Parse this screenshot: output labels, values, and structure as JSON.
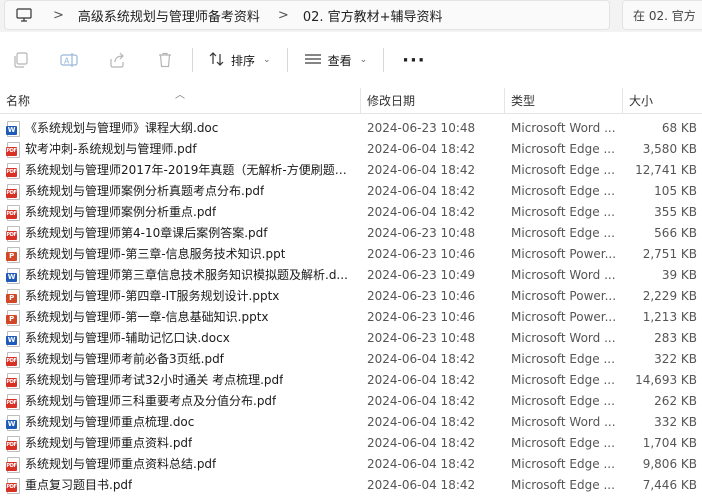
{
  "address": {
    "segments": [
      "高级系统规划与管理师备考资料",
      "02. 官方教材+辅导资料"
    ],
    "separator": ">",
    "search_placeholder": "在 02. 官方"
  },
  "toolbar": {
    "sort_label": "排序",
    "view_label": "查看",
    "more_label": "···"
  },
  "columns": {
    "name": "名称",
    "date": "修改日期",
    "type": "类型",
    "size": "大小"
  },
  "files": [
    {
      "icon": "word-icon",
      "kind": "word",
      "name": "《系统规划与管理师》课程大纲.doc",
      "date": "2024-06-23 10:48",
      "type": "Microsoft Word ...",
      "size": "68 KB"
    },
    {
      "icon": "pdf-icon",
      "kind": "pdf",
      "name": "软考冲刺-系统规划与管理师.pdf",
      "date": "2024-06-04 18:42",
      "type": "Microsoft Edge ...",
      "size": "3,580 KB"
    },
    {
      "icon": "pdf-icon",
      "kind": "pdf",
      "name": "系统规划与管理师2017年-2019年真题（无解析-方便刷题）...",
      "date": "2024-06-04 18:42",
      "type": "Microsoft Edge ...",
      "size": "12,741 KB"
    },
    {
      "icon": "pdf-icon",
      "kind": "pdf",
      "name": "系统规划与管理师案例分析真题考点分布.pdf",
      "date": "2024-06-04 18:42",
      "type": "Microsoft Edge ...",
      "size": "105 KB"
    },
    {
      "icon": "pdf-icon",
      "kind": "pdf",
      "name": "系统规划与管理师案例分析重点.pdf",
      "date": "2024-06-04 18:42",
      "type": "Microsoft Edge ...",
      "size": "355 KB"
    },
    {
      "icon": "pdf-icon",
      "kind": "pdf",
      "name": "系统规划与管理师第4-10章课后案例答案.pdf",
      "date": "2024-06-23 10:48",
      "type": "Microsoft Edge ...",
      "size": "566 KB"
    },
    {
      "icon": "ppt-icon",
      "kind": "ppt",
      "name": "系统规划与管理师-第三章-信息服务技术知识.ppt",
      "date": "2024-06-23 10:46",
      "type": "Microsoft Power...",
      "size": "2,751 KB"
    },
    {
      "icon": "word-icon",
      "kind": "word",
      "name": "系统规划与管理师第三章信息技术服务知识模拟题及解析.d...",
      "date": "2024-06-23 10:49",
      "type": "Microsoft Word ...",
      "size": "39 KB"
    },
    {
      "icon": "ppt-icon",
      "kind": "ppt",
      "name": "系统规划与管理师-第四章-IT服务规划设计.pptx",
      "date": "2024-06-23 10:46",
      "type": "Microsoft Power...",
      "size": "2,229 KB"
    },
    {
      "icon": "ppt-icon",
      "kind": "ppt",
      "name": "系统规划与管理师-第一章-信息基础知识.pptx",
      "date": "2024-06-23 10:46",
      "type": "Microsoft Power...",
      "size": "1,213 KB"
    },
    {
      "icon": "word-icon",
      "kind": "word",
      "name": "系统规划与管理师-辅助记忆口诀.docx",
      "date": "2024-06-23 10:48",
      "type": "Microsoft Word ...",
      "size": "283 KB"
    },
    {
      "icon": "pdf-icon",
      "kind": "pdf",
      "name": "系统规划与管理师考前必备3页纸.pdf",
      "date": "2024-06-04 18:42",
      "type": "Microsoft Edge ...",
      "size": "322 KB"
    },
    {
      "icon": "pdf-icon",
      "kind": "pdf",
      "name": "系统规划与管理师考试32小时通关 考点梳理.pdf",
      "date": "2024-06-04 18:42",
      "type": "Microsoft Edge ...",
      "size": "14,693 KB"
    },
    {
      "icon": "pdf-icon",
      "kind": "pdf",
      "name": "系统规划与管理师三科重要考点及分值分布.pdf",
      "date": "2024-06-04 18:42",
      "type": "Microsoft Edge ...",
      "size": "262 KB"
    },
    {
      "icon": "word-icon",
      "kind": "word",
      "name": "系统规划与管理师重点梳理.doc",
      "date": "2024-06-04 18:42",
      "type": "Microsoft Word ...",
      "size": "332 KB"
    },
    {
      "icon": "pdf-icon",
      "kind": "pdf",
      "name": "系统规划与管理师重点资料.pdf",
      "date": "2024-06-04 18:42",
      "type": "Microsoft Edge ...",
      "size": "1,704 KB"
    },
    {
      "icon": "pdf-icon",
      "kind": "pdf",
      "name": "系统规划与管理师重点资料总结.pdf",
      "date": "2024-06-04 18:42",
      "type": "Microsoft Edge ...",
      "size": "9,806 KB"
    },
    {
      "icon": "pdf-icon",
      "kind": "pdf",
      "name": "重点复习题目书.pdf",
      "date": "2024-06-04 18:42",
      "type": "Microsoft Edge ...",
      "size": "7,446 KB"
    }
  ]
}
